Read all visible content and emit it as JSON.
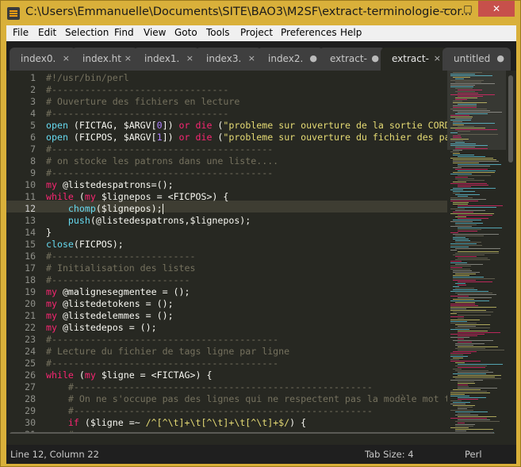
{
  "window": {
    "title": "C:\\Users\\Emmanuelle\\Documents\\SITE\\BAO3\\M2SF\\extract-terminologie-cor...",
    "buttons": {
      "minimize": "—",
      "maximize": "□",
      "close": "✕"
    }
  },
  "menu": [
    "File",
    "Edit",
    "Selection",
    "Find",
    "View",
    "Goto",
    "Tools",
    "Project",
    "Preferences",
    "Help"
  ],
  "tabs": [
    {
      "label": "index0.",
      "marker": "×"
    },
    {
      "label": "index.ht",
      "marker": "×"
    },
    {
      "label": "index1.",
      "marker": "×"
    },
    {
      "label": "index3.",
      "marker": "×"
    },
    {
      "label": "index2.",
      "marker": "●"
    },
    {
      "label": "extract-",
      "marker": "●"
    },
    {
      "label": "extract-",
      "marker": "×"
    },
    {
      "label": "untitled",
      "marker": "●"
    }
  ],
  "editor": {
    "current_line": 12,
    "lines": [
      [
        {
          "t": "c-comment",
          "v": "#!/usr/bin/perl"
        }
      ],
      [
        {
          "t": "c-comment",
          "v": "#--------------------------------"
        }
      ],
      [
        {
          "t": "c-comment",
          "v": "# Ouverture des fichiers en lecture"
        }
      ],
      [
        {
          "t": "c-comment",
          "v": "#--------------------------------"
        }
      ],
      [
        {
          "t": "c-fn",
          "v": "open"
        },
        {
          "t": "c-var",
          "v": " (FICTAG, $ARGV["
        },
        {
          "t": "c-num",
          "v": "0"
        },
        {
          "t": "c-var",
          "v": "]) "
        },
        {
          "t": "c-kw",
          "v": "or"
        },
        {
          "t": "c-var",
          "v": " "
        },
        {
          "t": "c-kw",
          "v": "die"
        },
        {
          "t": "c-var",
          "v": " ("
        },
        {
          "t": "c-str",
          "v": "\"probleme sur ouverture de la sortie CORD"
        }
      ],
      [
        {
          "t": "c-fn",
          "v": "open"
        },
        {
          "t": "c-var",
          "v": " (FICPOS, $ARGV["
        },
        {
          "t": "c-num",
          "v": "1"
        },
        {
          "t": "c-var",
          "v": "]) "
        },
        {
          "t": "c-kw",
          "v": "or"
        },
        {
          "t": "c-var",
          "v": " "
        },
        {
          "t": "c-kw",
          "v": "die"
        },
        {
          "t": "c-var",
          "v": " ("
        },
        {
          "t": "c-str",
          "v": "\"probleme sur ouverture du fichier des pa"
        }
      ],
      [
        {
          "t": "c-comment",
          "v": "#----------------------------------------"
        }
      ],
      [
        {
          "t": "c-comment",
          "v": "# on stocke les patrons dans une liste...."
        }
      ],
      [
        {
          "t": "c-comment",
          "v": "#----------------------------------------"
        }
      ],
      [
        {
          "t": "c-kw",
          "v": "my"
        },
        {
          "t": "c-var",
          "v": " @listedespatrons=();"
        }
      ],
      [
        {
          "t": "c-kw",
          "v": "while"
        },
        {
          "t": "c-var",
          "v": " ("
        },
        {
          "t": "c-kw",
          "v": "my"
        },
        {
          "t": "c-var",
          "v": " $lignepos = <FICPOS>) {"
        }
      ],
      [
        {
          "t": "c-var",
          "v": "    "
        },
        {
          "t": "c-fn",
          "v": "chomp"
        },
        {
          "t": "c-var",
          "v": "($lignepos);"
        },
        {
          "t": "caret",
          "v": ""
        }
      ],
      [
        {
          "t": "c-var",
          "v": "    "
        },
        {
          "t": "c-fn",
          "v": "push"
        },
        {
          "t": "c-var",
          "v": "(@listedespatrons,$lignepos);"
        }
      ],
      [
        {
          "t": "c-var",
          "v": "}"
        }
      ],
      [
        {
          "t": "c-fn",
          "v": "close"
        },
        {
          "t": "c-var",
          "v": "(FICPOS);"
        }
      ],
      [
        {
          "t": "c-comment",
          "v": "#--------------------------"
        }
      ],
      [
        {
          "t": "c-comment",
          "v": "# Initialisation des listes"
        }
      ],
      [
        {
          "t": "c-comment",
          "v": "#-------------------------"
        }
      ],
      [
        {
          "t": "c-kw",
          "v": "my"
        },
        {
          "t": "c-var",
          "v": " @malignesegmentee = ();"
        }
      ],
      [
        {
          "t": "c-kw",
          "v": "my"
        },
        {
          "t": "c-var",
          "v": " @listedetokens = ();"
        }
      ],
      [
        {
          "t": "c-kw",
          "v": "my"
        },
        {
          "t": "c-var",
          "v": " @listedelemmes = ();"
        }
      ],
      [
        {
          "t": "c-kw",
          "v": "my"
        },
        {
          "t": "c-var",
          "v": " @listedepos = ();"
        }
      ],
      [
        {
          "t": "c-comment",
          "v": "#-----------------------------------------"
        }
      ],
      [
        {
          "t": "c-comment",
          "v": "# Lecture du fichier de tags ligne par ligne"
        }
      ],
      [
        {
          "t": "c-comment",
          "v": "#-----------------------------------------"
        }
      ],
      [
        {
          "t": "c-kw",
          "v": "while"
        },
        {
          "t": "c-var",
          "v": " ("
        },
        {
          "t": "c-kw",
          "v": "my"
        },
        {
          "t": "c-var",
          "v": " $ligne = <FICTAG>) {"
        }
      ],
      [
        {
          "t": "c-var",
          "v": "    "
        },
        {
          "t": "c-comment",
          "v": "#------------------------------------------------------"
        }
      ],
      [
        {
          "t": "c-var",
          "v": "    "
        },
        {
          "t": "c-comment",
          "v": "# On ne s'occupe pas des lignes qui ne respectent pas la modèle mot t"
        }
      ],
      [
        {
          "t": "c-var",
          "v": "    "
        },
        {
          "t": "c-comment",
          "v": "#------------------------------------------------------"
        }
      ],
      [
        {
          "t": "c-var",
          "v": "    "
        },
        {
          "t": "c-kw",
          "v": "if"
        },
        {
          "t": "c-var",
          "v": " ($ligne =~ "
        },
        {
          "t": "c-str",
          "v": "/^[^\\t]+\\t[^\\t]+\\t[^\\t]+$/"
        },
        {
          "t": "c-var",
          "v": ") {"
        }
      ],
      [
        {
          "t": "c-var",
          "v": "    "
        },
        {
          "t": "c-comment",
          "v": "#--------------------------------------------"
        }
      ]
    ]
  },
  "status": {
    "position": "Line 12, Column 22",
    "tab_size": "Tab Size: 4",
    "syntax": "Perl"
  },
  "colors": {
    "editor_bg": "#272822",
    "comment": "#75715e",
    "keyword": "#f92672",
    "function": "#66d9ef",
    "string": "#e6db74",
    "number": "#ae81ff",
    "window_frame": "#d9b03a"
  }
}
